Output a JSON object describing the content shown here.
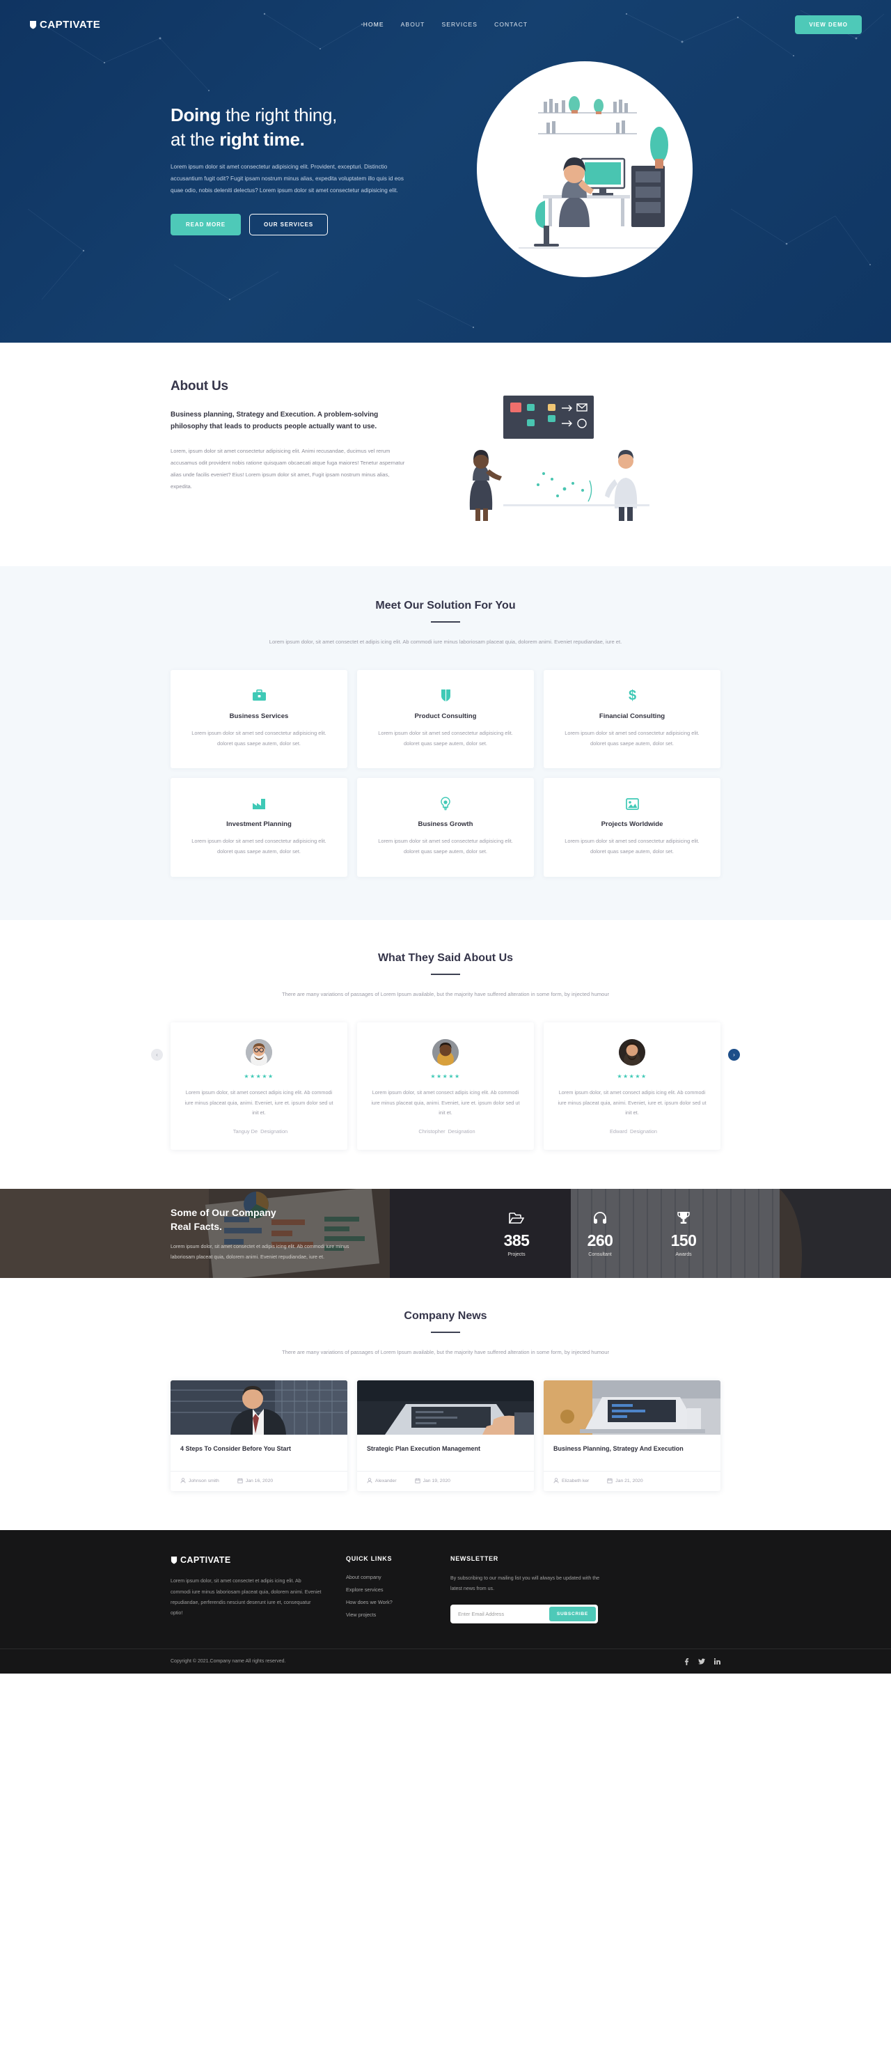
{
  "header": {
    "logo_text": "CAPTIVATE",
    "logo_icon": "shield-icon",
    "nav": [
      {
        "label": "HOME",
        "active": true
      },
      {
        "label": "ABOUT",
        "active": false
      },
      {
        "label": "SERVICES",
        "active": false
      },
      {
        "label": "CONTACT",
        "active": false
      }
    ],
    "cta_label": "VIEW DEMO",
    "accent_color": "#4ec9b8",
    "background_color": "#123a66"
  },
  "hero": {
    "title_line1_bold": "Doing",
    "title_line1_rest": " the right thing,",
    "title_line2_rest": "at the ",
    "title_line2_bold": "right time.",
    "paragraph": "Lorem ipsum dolor sit amet consectetur adipisicing elit. Provident, excepturi. Distinctio accusantium fugit odit? Fugit ipsam nostrum minus alias, expedita voluptatem illo quis id eos quae odio, nobis deleniti delectus? Lorem ipsum dolor sit amet consectetur adipisicing elit.",
    "primary_button": "READ MORE",
    "secondary_button": "OUR SERVICES",
    "illustration": "workspace-illustration"
  },
  "about": {
    "title": "About Us",
    "lead": "Business planning, Strategy and Execution. A problem-solving philosophy that leads to products people actually want to use.",
    "body": "Lorem, ipsum dolor sit amet consectetur adipisicing elit. Animi recusandae, ducimus vel rerum accusamus odit provident nobis ratione quisquam obcaecati atque fuga maiores! Tenetur aspernatur alias unde facilis eveniet? Eius! Lorem ipsum dolor sit amet, Fugit ipsam nostrum minus alias, expedita.",
    "illustration": "presentation-illustration"
  },
  "solutions": {
    "title": "Meet Our Solution For You",
    "subtitle": "Lorem ipsum dolor, sit amet consectet et adipis icing elit. Ab commodi iure minus laboriosam placeat quia, dolorem animi. Eveniet repudiandae, iure et.",
    "cards": [
      {
        "icon": "briefcase-icon",
        "title": "Business Services",
        "text": "Lorem ipsum dolor sit amet sed consectetur adipisicing elit. doloret quas saepe autem, dolor set."
      },
      {
        "icon": "shield-icon",
        "title": "Product Consulting",
        "text": "Lorem ipsum dolor sit amet sed consectetur adipisicing elit. doloret quas saepe autem, dolor set."
      },
      {
        "icon": "dollar-icon",
        "title": "Financial Consulting",
        "text": "Lorem ipsum dolor sit amet sed consectetur adipisicing elit. doloret quas saepe autem, dolor set."
      },
      {
        "icon": "factory-icon",
        "title": "Investment Planning",
        "text": "Lorem ipsum dolor sit amet sed consectetur adipisicing elit. doloret quas saepe autem, dolor set."
      },
      {
        "icon": "lightbulb-icon",
        "title": "Business Growth",
        "text": "Lorem ipsum dolor sit amet sed consectetur adipisicing elit. doloret quas saepe autem, dolor set."
      },
      {
        "icon": "image-icon",
        "title": "Projects Worldwide",
        "text": "Lorem ipsum dolor sit amet sed consectetur adipisicing elit. doloret quas saepe autem, dolor set."
      }
    ]
  },
  "testimonials": {
    "title": "What They Said About Us",
    "subtitle": "There are many variations of passages of Lorem Ipsum available, but the majority have suffered alteration in some form, by injected humour",
    "stars": "★★★★★",
    "prev_label": "‹",
    "next_label": "›",
    "items": [
      {
        "name": "Tanguy De",
        "designation": "Designation",
        "quote": "Lorem ipsum dolor, sit amet consect adipis icing elit. Ab commodi iure minus placeat quia, animi. Eveniet, iure et. ipsum dolor sed ut init et.",
        "avatar": "avatar-man-glasses"
      },
      {
        "name": "Christopher",
        "designation": "Designation",
        "quote": "Lorem ipsum dolor, sit amet consect adipis icing elit. Ab commodi iure minus placeat quia, animi. Eveniet, iure et. ipsum dolor sed ut init et.",
        "avatar": "avatar-man-dark"
      },
      {
        "name": "Edward",
        "designation": "Designation",
        "quote": "Lorem ipsum dolor, sit amet consect adipis icing elit. Ab commodi iure minus placeat quia, animi. Eveniet, iure et. ipsum dolor sed ut init et.",
        "avatar": "avatar-man-beard"
      }
    ]
  },
  "facts": {
    "title_line1": "Some of Our Company",
    "title_line2": "Real Facts.",
    "paragraph": "Lorem ipsum dolor, sit amet consectet et adipis icing elit. Ab commodi iure minus laboriosam placeat quia, dolorem animi. Eveniet repudiandae, iure et.",
    "stats": [
      {
        "icon": "folder-icon",
        "value": "385",
        "label": "Projects"
      },
      {
        "icon": "headphones-icon",
        "value": "260",
        "label": "Consultant"
      },
      {
        "icon": "trophy-icon",
        "value": "150",
        "label": "Awards"
      }
    ]
  },
  "news": {
    "title": "Company News",
    "subtitle": "There are many variations of passages of Lorem Ipsum available, but the majority have suffered alteration in some form, by injected humour",
    "items": [
      {
        "title": "4 Steps To Consider Before You Start",
        "author": "Johnson smith",
        "date": "Jan 16, 2020",
        "thumb": "businessman-photo"
      },
      {
        "title": "Strategic Plan Execution Management",
        "author": "Alexander",
        "date": "Jan 19, 2020",
        "thumb": "laptop-hands-photo"
      },
      {
        "title": "Business Planning, Strategy And Execution",
        "author": "Elizabeth ker",
        "date": "Jan 21, 2020",
        "thumb": "laptop-desk-photo"
      }
    ]
  },
  "footer": {
    "logo_text": "CAPTIVATE",
    "about": "Lorem ipsum dolor, sit amet consectet et adipis icing elit. Ab commodi iure minus laboriosam placeat quia, dolorem animi. Eveniet repudiandae, perferendis nesciunt deserunt iure et, consequatur optio!",
    "quick_links_title": "QUICK LINKS",
    "quick_links": [
      "About company",
      "Explore services",
      "How does we Work?",
      "View projects"
    ],
    "newsletter_title": "NEWSLETTER",
    "newsletter_text": "By subscribing to our mailing list you will always be updated with the latest news from us.",
    "email_placeholder": "Enter Email Address",
    "email_value": "",
    "subscribe_label": "SUBSCRIBE",
    "copyright": "Copyright © 2021.Company name All rights reserved.",
    "socials": [
      "facebook-icon",
      "twitter-icon",
      "linkedin-icon"
    ]
  }
}
